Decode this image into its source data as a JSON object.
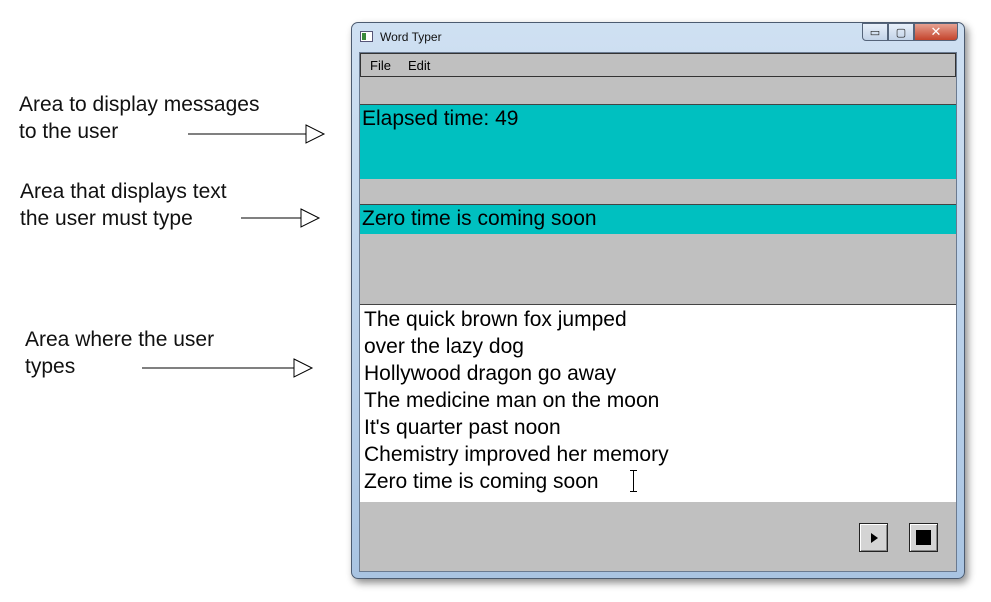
{
  "annotations": {
    "messages": "Area to display messages\nto the user",
    "target": "Area that displays text\nthe user must type",
    "typing": "Area where the user\ntypes"
  },
  "window": {
    "title": "Word Typer",
    "buttons": {
      "minimize": "▭",
      "maximize": "▢",
      "close": "✕"
    }
  },
  "menu": {
    "items": [
      "File",
      "Edit"
    ]
  },
  "message_area": {
    "text": "Elapsed time: 49",
    "background": "#00c0c0"
  },
  "target_area": {
    "text": "Zero time is coming soon",
    "background": "#00c0c0"
  },
  "typing_area": {
    "lines": [
      "The quick brown fox jumped",
      "over the lazy dog",
      "Hollywood dragon go away",
      "The medicine man on the moon",
      "It's quarter past noon",
      "Chemistry improved her memory",
      "Zero time is coming soon"
    ]
  },
  "controls": {
    "play_icon": "play-icon",
    "stop_icon": "stop-icon"
  }
}
